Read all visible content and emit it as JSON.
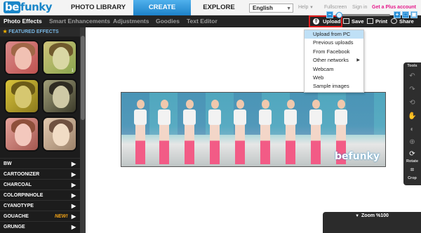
{
  "app": {
    "logo_text": "befunky",
    "nav": [
      "PHOTO LIBRARY",
      "CREATE",
      "EXPLORE"
    ],
    "active_nav": "CREATE",
    "language": "English",
    "links": {
      "help": "Help",
      "fullscreen": "Fullscreen",
      "signin": "Sign in",
      "plus": "Get a Plus account"
    },
    "colors": {
      "accent": "#1d82c9",
      "plus_link": "#e5198a",
      "highlight_border": "#e31d1d"
    }
  },
  "subbar": {
    "tabs": [
      "Photo Effects",
      "Smart Enhancements",
      "Adjustments",
      "Goodies",
      "Text Editor"
    ],
    "active_tab": "Photo Effects",
    "tools": {
      "upload": "Upload",
      "save": "Save",
      "print": "Print",
      "share": "Share"
    },
    "icons": {
      "upload": "upload-icon",
      "save": "save-icon",
      "print": "print-icon",
      "share": "share-icon"
    }
  },
  "sidebar": {
    "section_title": "FEATURED EFFECTS",
    "thumb_numbers": [
      "",
      "1",
      "",
      "",
      "",
      ""
    ],
    "categories": [
      {
        "label": "BW",
        "badge": ""
      },
      {
        "label": "CARTOONIZER",
        "badge": ""
      },
      {
        "label": "CHARCOAL",
        "badge": ""
      },
      {
        "label": "COLORPINHOLE",
        "badge": ""
      },
      {
        "label": "CYANOTYPE",
        "badge": ""
      },
      {
        "label": "GOUACHE",
        "badge": "NEW!"
      },
      {
        "label": "GRUNGE",
        "badge": ""
      }
    ]
  },
  "upload_menu": {
    "items": [
      "Upload from PC",
      "Previous uploads",
      "From Facebook",
      "Other networks",
      "Webcam",
      "Web",
      "Sample images"
    ],
    "selected": "Upload from PC",
    "submenu_item": "Other networks"
  },
  "canvas": {
    "watermark": "befunky"
  },
  "tools_panel": {
    "title": "Tools",
    "rotate_label": "Rotate",
    "crop_label": "Crop"
  },
  "zoom": {
    "label": "Zoom %100",
    "level_percent": 100
  }
}
